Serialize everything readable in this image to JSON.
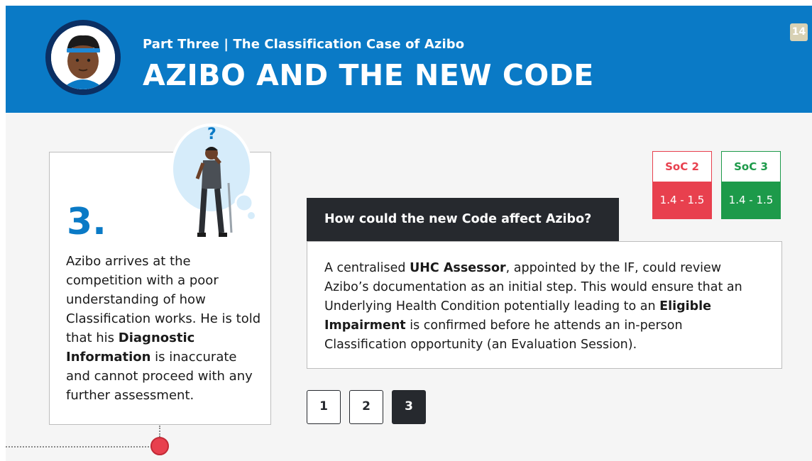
{
  "header": {
    "subtitle": "Part Three | The Classification Case of Azibo",
    "title": "AZIBO AND THE NEW CODE",
    "page_number": "14"
  },
  "step_card": {
    "number": "3.",
    "text_1": "Azibo arrives at the competition with a poor understanding of how Classification works. He is told that his ",
    "bold_1": "Diagnostic Information",
    "text_2": " is inaccurate and cannot proceed with any further assessment."
  },
  "soc_boxes": [
    {
      "title": "SoC 2",
      "value": "1.4 - 1.5",
      "color": "#e8404e"
    },
    {
      "title": "SoC 3",
      "value": "1.4 - 1.5",
      "color": "#1d9a4a"
    }
  ],
  "question": {
    "label": "How could the new Code affect Azibo?"
  },
  "answer": {
    "text_1": "A centralised ",
    "bold_1": "UHC Assessor",
    "text_2": ", appointed by the IF, could review Azibo’s documentation as an initial step. This would ensure that an Underlying Health Condition potentially leading to an ",
    "bold_2": "Eligible Impairment",
    "text_3": " is confirmed before he attends an in-person Classification opportunity (an Evaluation Session)."
  },
  "pager": {
    "pages": [
      "1",
      "2",
      "3"
    ],
    "active": "3"
  },
  "colors": {
    "header_blue": "#0a7ac6",
    "dark": "#26292e",
    "accent_red": "#e8404e",
    "accent_green": "#1d9a4a"
  },
  "icons": {
    "avatar": "athlete-avatar-icon",
    "illustration": "confused-athlete-icon",
    "timeline_marker": "timeline-dot-icon"
  }
}
